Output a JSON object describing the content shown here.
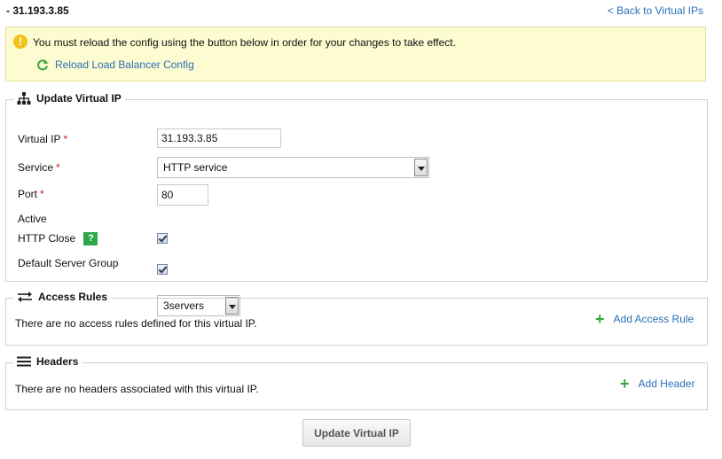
{
  "header": {
    "title": "- 31.193.3.85",
    "back_link": "< Back to Virtual IPs"
  },
  "notice": {
    "message": "You must reload the config using the button below in order for your changes to take effect.",
    "icon": "exclamation-icon",
    "reload_label": "Reload Load Balancer Config"
  },
  "update_section": {
    "legend": "Update Virtual IP",
    "fields": {
      "virtual_ip": {
        "label": "Virtual IP",
        "required": "*",
        "value": "31.193.3.85"
      },
      "service": {
        "label": "Service",
        "required": "*",
        "value": "HTTP service"
      },
      "port": {
        "label": "Port",
        "required": "*",
        "value": "80"
      },
      "active": {
        "label": "Active",
        "checked": true
      },
      "http_close": {
        "label": "HTTP Close",
        "help": "?",
        "checked": true
      },
      "default_server_group": {
        "label": "Default Server Group",
        "value": "3servers"
      }
    }
  },
  "access_rules": {
    "legend": "Access Rules",
    "empty_text": "There are no access rules defined for this virtual IP.",
    "add_label": "Add Access Rule"
  },
  "headers": {
    "legend": "Headers",
    "empty_text": "There are no headers associated with this virtual IP.",
    "add_label": "Add Header"
  },
  "submit_label": "Update Virtual IP",
  "colors": {
    "link": "#2a6fb7",
    "notice_bg": "#fdfbd0",
    "required": "#d01717",
    "add_icon": "#3aa63a"
  }
}
